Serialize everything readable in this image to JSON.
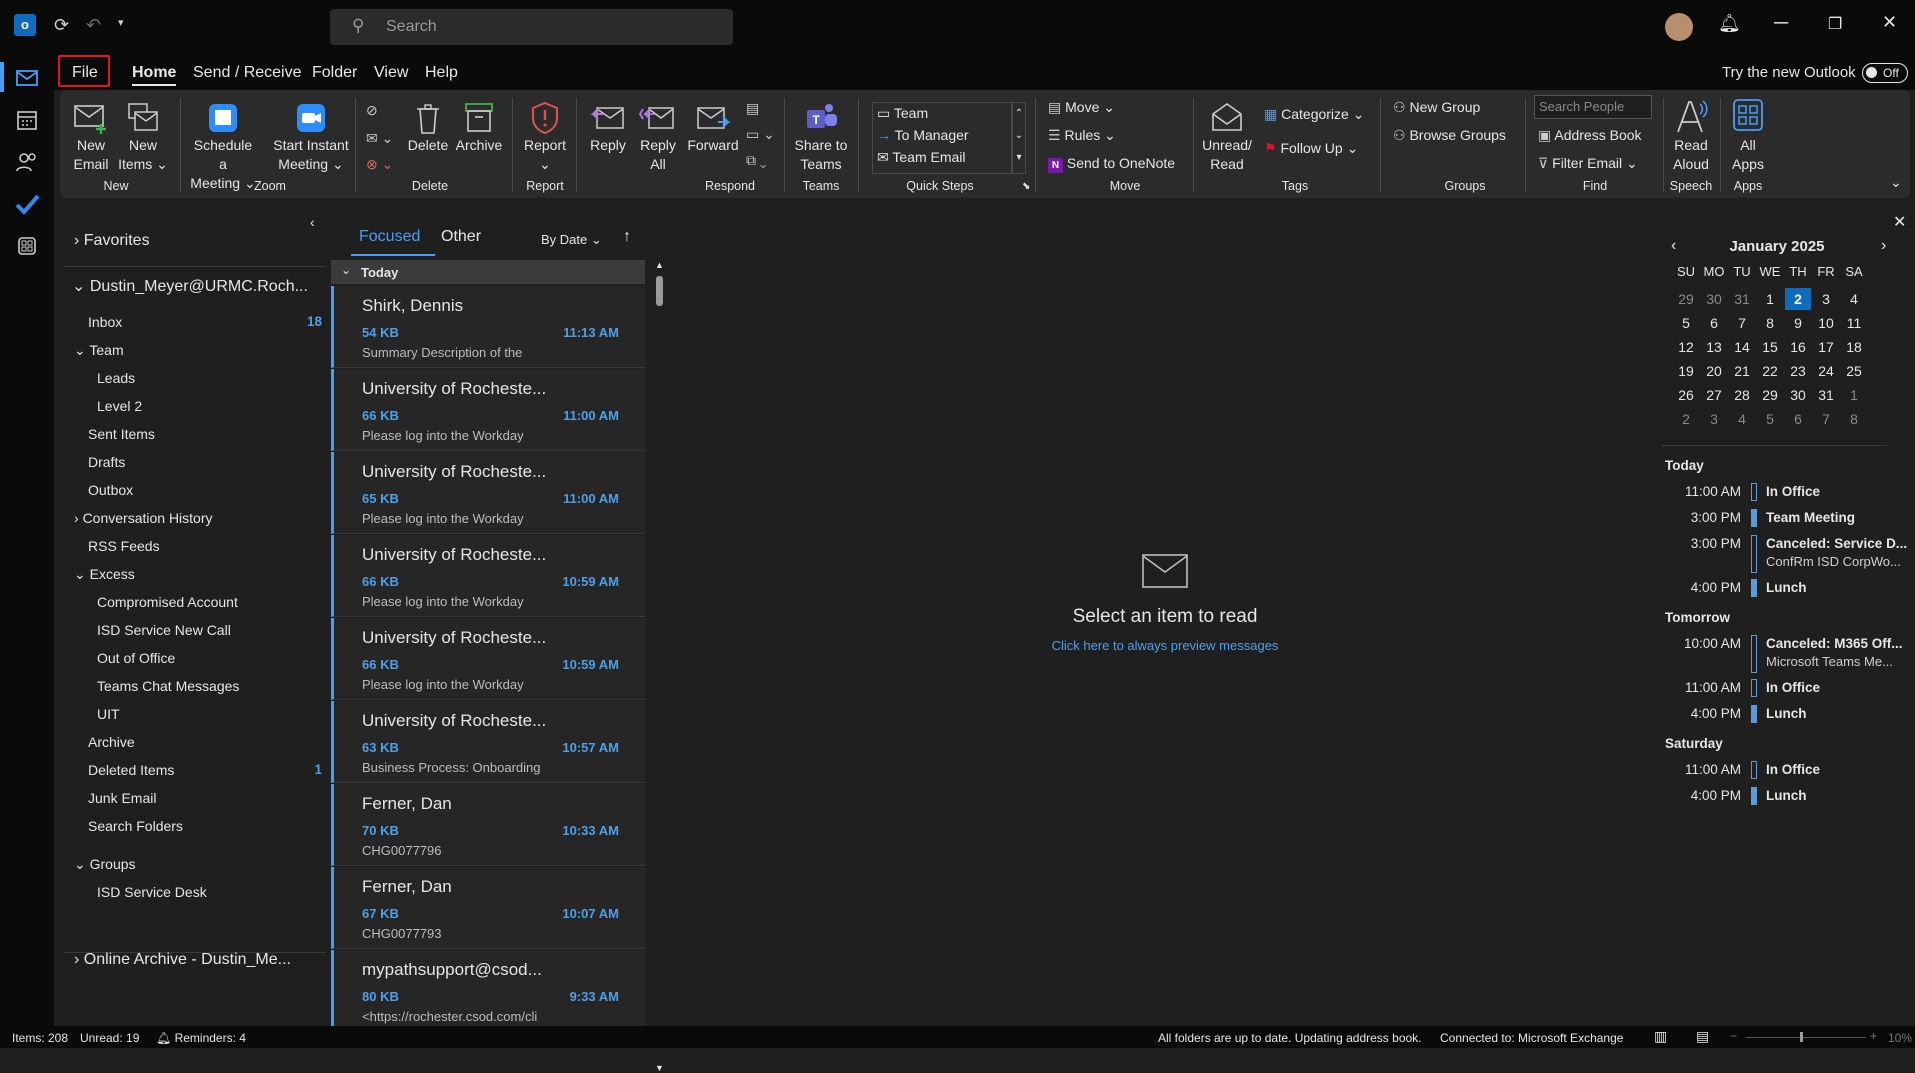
{
  "titlebar": {
    "search_placeholder": "Search"
  },
  "menu": {
    "items": [
      "File",
      "Home",
      "Send / Receive",
      "Folder",
      "View",
      "Help"
    ],
    "try_new": "Try the new Outlook",
    "toggle": "Off"
  },
  "ribbon": {
    "new_email": [
      "New",
      "Email"
    ],
    "new_items": [
      "New",
      "Items"
    ],
    "group_new": "New",
    "schedule": [
      "Schedule a",
      "Meeting"
    ],
    "instant": [
      "Start Instant",
      "Meeting"
    ],
    "group_zoom": "Zoom",
    "delete": "Delete",
    "archive": "Archive",
    "group_delete": "Delete",
    "report": "Report",
    "group_report": "Report",
    "reply": "Reply",
    "reply_all": [
      "Reply",
      "All"
    ],
    "forward": "Forward",
    "group_respond": "Respond",
    "share_teams": [
      "Share to",
      "Teams"
    ],
    "group_teams": "Teams",
    "quicksteps": [
      "Team",
      "To Manager",
      "Team Email"
    ],
    "group_quick": "Quick Steps",
    "move": "Move",
    "rules": "Rules",
    "onenote": "Send to OneNote",
    "group_move": "Move",
    "unread": [
      "Unread/",
      "Read"
    ],
    "categorize": "Categorize",
    "followup": "Follow Up",
    "group_tags": "Tags",
    "new_group": "New Group",
    "browse_groups": "Browse Groups",
    "group_groups": "Groups",
    "search_people": "Search People",
    "address_book": "Address Book",
    "filter_email": "Filter Email",
    "group_find": "Find",
    "read_aloud": [
      "Read",
      "Aloud"
    ],
    "group_speech": "Speech",
    "all_apps": [
      "All",
      "Apps"
    ],
    "group_apps": "Apps"
  },
  "folders": {
    "favorites": "Favorites",
    "account": "Dustin_Meyer@URMC.Roch...",
    "items": [
      {
        "label": "Inbox",
        "count": "18"
      },
      {
        "label": "Team"
      },
      {
        "label": "Leads"
      },
      {
        "label": "Level 2"
      },
      {
        "label": "Sent Items"
      },
      {
        "label": "Drafts"
      },
      {
        "label": "Outbox"
      },
      {
        "label": "Conversation History"
      },
      {
        "label": "RSS Feeds"
      },
      {
        "label": "Excess"
      },
      {
        "label": "Compromised Account"
      },
      {
        "label": "ISD Service New Call"
      },
      {
        "label": "Out of Office"
      },
      {
        "label": "Teams Chat Messages"
      },
      {
        "label": "UIT"
      },
      {
        "label": "Archive"
      },
      {
        "label": "Deleted Items",
        "count": "1"
      },
      {
        "label": "Junk Email"
      },
      {
        "label": "Search Folders"
      },
      {
        "label": "Groups"
      },
      {
        "label": "ISD Service Desk"
      }
    ],
    "online_archive": "Online Archive - Dustin_Me..."
  },
  "list": {
    "tab_focused": "Focused",
    "tab_other": "Other",
    "sort": "By Date",
    "group_today": "Today",
    "messages": [
      {
        "from": "Shirk, Dennis",
        "size": "54 KB",
        "time": "11:13 AM",
        "preview": "Summary Description of the"
      },
      {
        "from": "University of Rocheste...",
        "size": "66 KB",
        "time": "11:00 AM",
        "preview": "Please log into the Workday"
      },
      {
        "from": "University of Rocheste...",
        "size": "65 KB",
        "time": "11:00 AM",
        "preview": "Please log into the Workday"
      },
      {
        "from": "University of Rocheste...",
        "size": "66 KB",
        "time": "10:59 AM",
        "preview": "Please log into the Workday"
      },
      {
        "from": "University of Rocheste...",
        "size": "66 KB",
        "time": "10:59 AM",
        "preview": "Please log into the Workday"
      },
      {
        "from": "University of Rocheste...",
        "size": "63 KB",
        "time": "10:57 AM",
        "preview": "Business Process: Onboarding"
      },
      {
        "from": "Ferner, Dan",
        "size": "70 KB",
        "time": "10:33 AM",
        "preview": "CHG0077796"
      },
      {
        "from": "Ferner, Dan",
        "size": "67 KB",
        "time": "10:07 AM",
        "preview": "CHG0077793"
      },
      {
        "from": "mypathsupport@csod...",
        "size": "80 KB",
        "time": "9:33 AM",
        "preview": "<https://rochester.csod.com/cli"
      }
    ]
  },
  "reading": {
    "title": "Select an item to read",
    "link": "Click here to always preview messages"
  },
  "calendar": {
    "month": "January 2025",
    "days": [
      "SU",
      "MO",
      "TU",
      "WE",
      "TH",
      "FR",
      "SA"
    ],
    "weeks": [
      [
        "29",
        "30",
        "31",
        "1",
        "2",
        "3",
        "4"
      ],
      [
        "5",
        "6",
        "7",
        "8",
        "9",
        "10",
        "11"
      ],
      [
        "12",
        "13",
        "14",
        "15",
        "16",
        "17",
        "18"
      ],
      [
        "19",
        "20",
        "21",
        "22",
        "23",
        "24",
        "25"
      ],
      [
        "26",
        "27",
        "28",
        "29",
        "30",
        "31",
        "1"
      ],
      [
        "2",
        "3",
        "4",
        "5",
        "6",
        "7",
        "8"
      ]
    ],
    "today": "2"
  },
  "agenda": [
    {
      "header": "Today"
    },
    {
      "time": "11:00 AM",
      "title": "In Office",
      "style": "outline"
    },
    {
      "time": "3:00 PM",
      "title": "Team Meeting",
      "style": "solid"
    },
    {
      "time": "3:00 PM",
      "title": "Canceled: Service D...",
      "sub": "ConfRm ISD CorpWo...",
      "style": "outline"
    },
    {
      "time": "4:00 PM",
      "title": "Lunch",
      "style": "solid"
    },
    {
      "header": "Tomorrow"
    },
    {
      "time": "10:00 AM",
      "title": "Canceled: M365 Off...",
      "sub": "Microsoft Teams Me...",
      "style": "outline"
    },
    {
      "time": "11:00 AM",
      "title": "In Office",
      "style": "outline"
    },
    {
      "time": "4:00 PM",
      "title": "Lunch",
      "style": "solid"
    },
    {
      "header": "Saturday"
    },
    {
      "time": "11:00 AM",
      "title": "In Office",
      "style": "outline"
    },
    {
      "time": "4:00 PM",
      "title": "Lunch",
      "style": "solid"
    }
  ],
  "status": {
    "items": "Items: 208",
    "unread": "Unread: 19",
    "reminders": "Reminders: 4",
    "sync": "All folders are up to date.  Updating address book.",
    "connected": "Connected to: Microsoft Exchange",
    "zoom": "10%"
  },
  "colors": {
    "accent": "#479ef5",
    "highlight": "#e81123",
    "today": "#0f6cbd"
  }
}
